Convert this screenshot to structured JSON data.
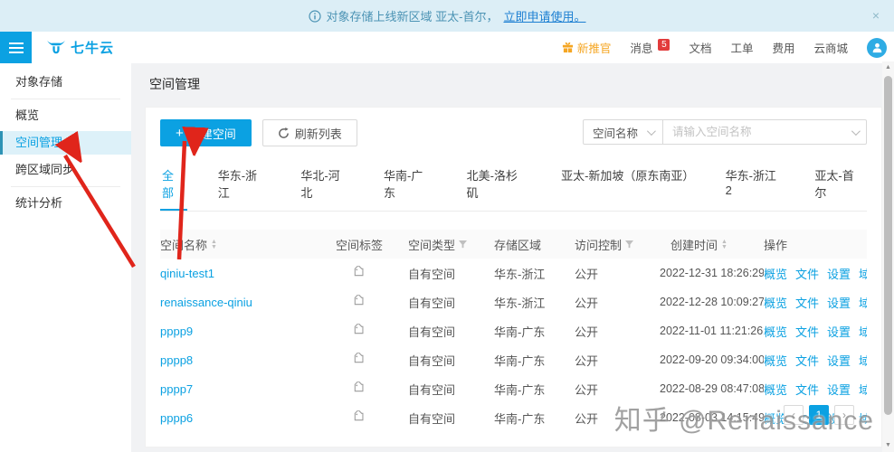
{
  "banner": {
    "text": "对象存储上线新区域 亚太-首尔，",
    "link": "立即申请使用。",
    "close": "×"
  },
  "topnav": {
    "logo": "七牛云",
    "promo": "新推官",
    "items": {
      "messages": "消息",
      "docs": "文档",
      "tickets": "工单",
      "billing": "费用",
      "market": "云商城"
    },
    "message_badge": "5"
  },
  "sidebar": {
    "items": [
      {
        "label": "对象存储"
      },
      {
        "label": "概览"
      },
      {
        "label": "空间管理"
      },
      {
        "label": "跨区域同步"
      },
      {
        "label": "统计分析"
      }
    ]
  },
  "page": {
    "title": "空间管理"
  },
  "toolbar": {
    "new_button": "新建空间",
    "refresh_button": "刷新列表",
    "plus": "+"
  },
  "search": {
    "field_select": "空间名称",
    "placeholder": "请输入空间名称"
  },
  "tabs": [
    "全部",
    "华东-浙江",
    "华北-河北",
    "华南-广东",
    "北美-洛杉矶",
    "亚太-新加坡（原东南亚）",
    "华东-浙江2",
    "亚太-首尔"
  ],
  "table": {
    "headers": [
      "空间名称",
      "空间标签",
      "空间类型",
      "存储区域",
      "访问控制",
      "创建时间",
      "操作"
    ],
    "actions": [
      "概览",
      "文件",
      "设置",
      "域名"
    ],
    "rows": [
      {
        "name": "qiniu-test1",
        "type": "自有空间",
        "region": "华东-浙江",
        "access": "公开",
        "created": "2022-12-31 18:26:29"
      },
      {
        "name": "renaissance-qiniu",
        "type": "自有空间",
        "region": "华东-浙江",
        "access": "公开",
        "created": "2022-12-28 10:09:27"
      },
      {
        "name": "pppp9",
        "type": "自有空间",
        "region": "华南-广东",
        "access": "公开",
        "created": "2022-11-01 11:21:26"
      },
      {
        "name": "pppp8",
        "type": "自有空间",
        "region": "华南-广东",
        "access": "公开",
        "created": "2022-09-20 09:34:00"
      },
      {
        "name": "pppp7",
        "type": "自有空间",
        "region": "华南-广东",
        "access": "公开",
        "created": "2022-08-29 08:47:08"
      },
      {
        "name": "pppp6",
        "type": "自有空间",
        "region": "华南-广东",
        "access": "公开",
        "created": "2022-08-03 14:15:49"
      }
    ]
  },
  "pagination": {
    "prev": "‹",
    "current": "1",
    "next": "›"
  },
  "watermark": "知乎 @Renaissance",
  "colors": {
    "brand": "#0ba1e2",
    "banner_bg": "#dceef6",
    "badge_red": "#e23c3c",
    "promo_orange": "#f5a623",
    "arrow_red": "#e0251b",
    "active_bg": "#ddf1f9"
  }
}
